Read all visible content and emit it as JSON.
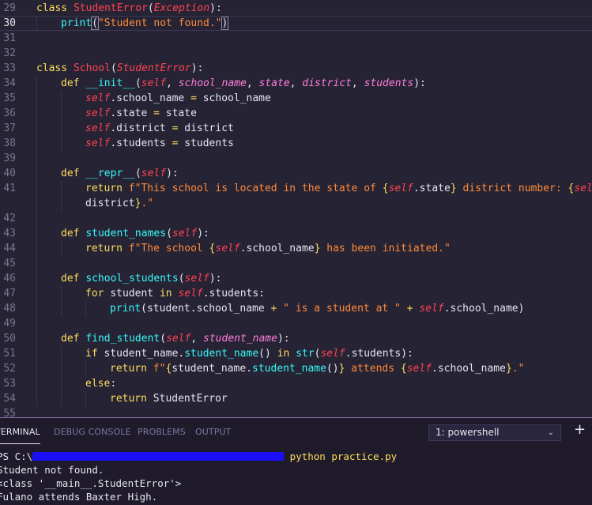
{
  "editor": {
    "lines": [
      {
        "n": "29",
        "indent": 0,
        "parts": [
          [
            "kw",
            "class "
          ],
          [
            "cls",
            "StudentError"
          ],
          [
            "tx",
            "("
          ],
          [
            "bi",
            "Exception"
          ],
          [
            "tx",
            "):"
          ]
        ]
      },
      {
        "n": "30",
        "indent": 1,
        "current": true,
        "parts": [
          [
            "fn",
            "print"
          ],
          [
            "tx",
            "("
          ],
          [
            "str",
            "\"Student not found.\""
          ],
          [
            "tx",
            ")"
          ]
        ]
      },
      {
        "n": "31",
        "indent": 0,
        "parts": []
      },
      {
        "n": "32",
        "indent": 0,
        "parts": []
      },
      {
        "n": "33",
        "indent": 0,
        "parts": [
          [
            "kw",
            "class "
          ],
          [
            "cls",
            "School"
          ],
          [
            "tx",
            "("
          ],
          [
            "bi",
            "StudentError"
          ],
          [
            "tx",
            "):"
          ]
        ]
      },
      {
        "n": "34",
        "indent": 1,
        "parts": [
          [
            "kw",
            "def "
          ],
          [
            "fn",
            "__init__"
          ],
          [
            "tx",
            "("
          ],
          [
            "sf",
            "self"
          ],
          [
            "tx",
            ", "
          ],
          [
            "par",
            "school_name"
          ],
          [
            "tx",
            ", "
          ],
          [
            "par",
            "state"
          ],
          [
            "tx",
            ", "
          ],
          [
            "par",
            "district"
          ],
          [
            "tx",
            ", "
          ],
          [
            "par",
            "students"
          ],
          [
            "tx",
            "):"
          ]
        ]
      },
      {
        "n": "35",
        "indent": 2,
        "parts": [
          [
            "sf",
            "self"
          ],
          [
            "tx",
            ".school_name "
          ],
          [
            "op",
            "="
          ],
          [
            "tx",
            " school_name"
          ]
        ]
      },
      {
        "n": "36",
        "indent": 2,
        "parts": [
          [
            "sf",
            "self"
          ],
          [
            "tx",
            ".state "
          ],
          [
            "op",
            "="
          ],
          [
            "tx",
            " state"
          ]
        ]
      },
      {
        "n": "37",
        "indent": 2,
        "parts": [
          [
            "sf",
            "self"
          ],
          [
            "tx",
            ".district "
          ],
          [
            "op",
            "="
          ],
          [
            "tx",
            " district"
          ]
        ]
      },
      {
        "n": "38",
        "indent": 2,
        "parts": [
          [
            "sf",
            "self"
          ],
          [
            "tx",
            ".students "
          ],
          [
            "op",
            "="
          ],
          [
            "tx",
            " students"
          ]
        ]
      },
      {
        "n": "39",
        "indent": 1,
        "parts": []
      },
      {
        "n": "40",
        "indent": 1,
        "parts": [
          [
            "kw",
            "def "
          ],
          [
            "fn",
            "__repr__"
          ],
          [
            "tx",
            "("
          ],
          [
            "sf",
            "self"
          ],
          [
            "tx",
            "):"
          ]
        ]
      },
      {
        "n": "41",
        "indent": 2,
        "parts": [
          [
            "kw",
            "return "
          ],
          [
            "str",
            "f\"This school is located in the state of "
          ],
          [
            "op",
            "{"
          ],
          [
            "sf",
            "self"
          ],
          [
            "tx",
            ".state"
          ],
          [
            "op",
            "}"
          ],
          [
            "str",
            " district number: "
          ],
          [
            "op",
            "{"
          ],
          [
            "sf",
            "self"
          ],
          [
            "tx",
            "."
          ]
        ]
      },
      {
        "n": "",
        "indent": 2,
        "parts": [
          [
            "tx",
            "district"
          ],
          [
            "op",
            "}"
          ],
          [
            "str",
            ".\""
          ]
        ]
      },
      {
        "n": "42",
        "indent": 1,
        "parts": []
      },
      {
        "n": "43",
        "indent": 1,
        "parts": [
          [
            "kw",
            "def "
          ],
          [
            "fn",
            "student_names"
          ],
          [
            "tx",
            "("
          ],
          [
            "sf",
            "self"
          ],
          [
            "tx",
            "):"
          ]
        ]
      },
      {
        "n": "44",
        "indent": 2,
        "parts": [
          [
            "kw",
            "return "
          ],
          [
            "str",
            "f\"The school "
          ],
          [
            "op",
            "{"
          ],
          [
            "sf",
            "self"
          ],
          [
            "tx",
            ".school_name"
          ],
          [
            "op",
            "}"
          ],
          [
            "str",
            " has been initiated.\""
          ]
        ]
      },
      {
        "n": "45",
        "indent": 1,
        "parts": []
      },
      {
        "n": "46",
        "indent": 1,
        "parts": [
          [
            "kw",
            "def "
          ],
          [
            "fn",
            "school_students"
          ],
          [
            "tx",
            "("
          ],
          [
            "sf",
            "self"
          ],
          [
            "tx",
            "):"
          ]
        ]
      },
      {
        "n": "47",
        "indent": 2,
        "parts": [
          [
            "kw",
            "for "
          ],
          [
            "tx",
            "student "
          ],
          [
            "kw",
            "in "
          ],
          [
            "sf",
            "self"
          ],
          [
            "tx",
            ".students:"
          ]
        ]
      },
      {
        "n": "48",
        "indent": 3,
        "parts": [
          [
            "fn",
            "print"
          ],
          [
            "tx",
            "(student.school_name "
          ],
          [
            "op",
            "+"
          ],
          [
            "str",
            " \" is a student at \" "
          ],
          [
            "op",
            "+"
          ],
          [
            "tx",
            " "
          ],
          [
            "sf",
            "self"
          ],
          [
            "tx",
            ".school_name)"
          ]
        ]
      },
      {
        "n": "49",
        "indent": 1,
        "parts": []
      },
      {
        "n": "50",
        "indent": 1,
        "parts": [
          [
            "kw",
            "def "
          ],
          [
            "fn",
            "find_student"
          ],
          [
            "tx",
            "("
          ],
          [
            "sf",
            "self"
          ],
          [
            "tx",
            ", "
          ],
          [
            "par",
            "student_name"
          ],
          [
            "tx",
            "):"
          ]
        ]
      },
      {
        "n": "51",
        "indent": 2,
        "parts": [
          [
            "kw",
            "if "
          ],
          [
            "tx",
            "student_name."
          ],
          [
            "fn",
            "student_name"
          ],
          [
            "tx",
            "() "
          ],
          [
            "kw",
            "in "
          ],
          [
            "fn",
            "str"
          ],
          [
            "tx",
            "("
          ],
          [
            "sf",
            "self"
          ],
          [
            "tx",
            ".students):"
          ]
        ]
      },
      {
        "n": "52",
        "indent": 3,
        "parts": [
          [
            "kw",
            "return "
          ],
          [
            "str",
            "f\""
          ],
          [
            "op",
            "{"
          ],
          [
            "tx",
            "student_name."
          ],
          [
            "fn",
            "student_name"
          ],
          [
            "tx",
            "()"
          ],
          [
            "op",
            "}"
          ],
          [
            "str",
            " attends "
          ],
          [
            "op",
            "{"
          ],
          [
            "sf",
            "self"
          ],
          [
            "tx",
            ".school_name"
          ],
          [
            "op",
            "}"
          ],
          [
            "str",
            ".\""
          ]
        ]
      },
      {
        "n": "53",
        "indent": 2,
        "parts": [
          [
            "kw",
            "else"
          ],
          [
            "tx",
            ":"
          ]
        ]
      },
      {
        "n": "54",
        "indent": 3,
        "parts": [
          [
            "kw",
            "return "
          ],
          [
            "tx",
            "StudentError"
          ]
        ]
      },
      {
        "n": "55",
        "indent": 0,
        "parts": []
      }
    ]
  },
  "panel": {
    "tabs": [
      {
        "label": "TERMINAL",
        "active": true
      },
      {
        "label": "DEBUG CONSOLE",
        "active": false
      },
      {
        "label": "PROBLEMS",
        "active": false
      },
      {
        "label": "OUTPUT",
        "active": false
      }
    ],
    "terminal_select": {
      "value": "1: powershell",
      "chevron": "⌄"
    },
    "add_label": "+",
    "terminal": {
      "prompt_prefix": "PS C:\\",
      "command": " python practice.py",
      "output": [
        "Student not found.",
        "<class '__main__.StudentError'>",
        "Fulano attends Baxter High."
      ]
    }
  },
  "colors": {
    "background": "#262335",
    "keyword": "#fede5d",
    "class_name": "#fe4450",
    "function": "#36f9f6",
    "string": "#ff8b39",
    "parameter": "#ff7edb"
  }
}
